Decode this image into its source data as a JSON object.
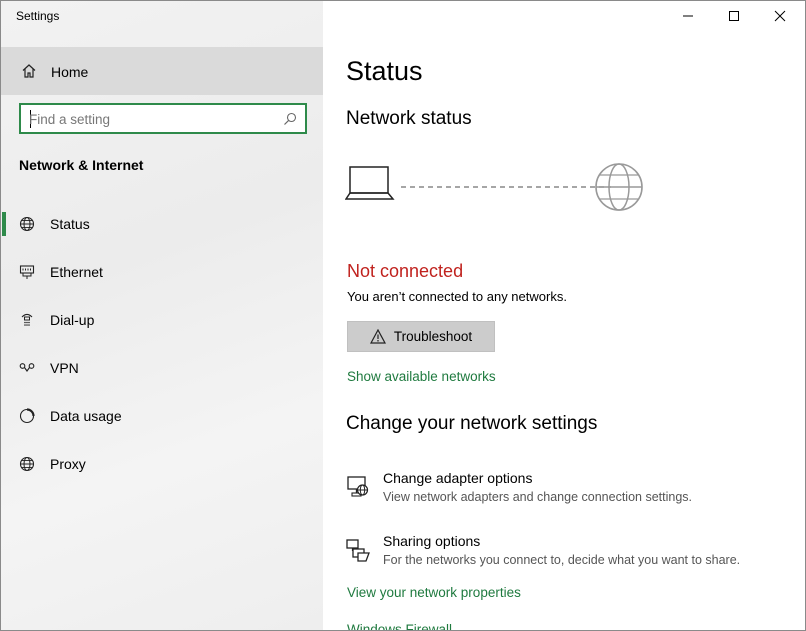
{
  "window": {
    "title": "Settings"
  },
  "sidebar": {
    "home_label": "Home",
    "search": {
      "placeholder": "Find a setting",
      "value": ""
    },
    "section": "Network & Internet",
    "items": [
      {
        "label": "Status",
        "icon": "globe-status-icon",
        "selected": true
      },
      {
        "label": "Ethernet",
        "icon": "ethernet-icon"
      },
      {
        "label": "Dial-up",
        "icon": "dialup-icon"
      },
      {
        "label": "VPN",
        "icon": "vpn-icon"
      },
      {
        "label": "Data usage",
        "icon": "data-usage-icon"
      },
      {
        "label": "Proxy",
        "icon": "globe-icon"
      }
    ]
  },
  "main": {
    "title": "Status",
    "network_status_heading": "Network status",
    "status": "Not connected",
    "status_description": "You aren’t connected to any networks.",
    "troubleshoot_label": "Troubleshoot",
    "show_networks_link": "Show available networks",
    "change_heading": "Change your network settings",
    "options": [
      {
        "title": "Change adapter options",
        "description": "View network adapters and change connection settings."
      },
      {
        "title": "Sharing options",
        "description": "For the networks you connect to, decide what you want to share."
      }
    ],
    "view_properties_link": "View your network properties",
    "firewall_link": "Windows Firewall"
  },
  "colors": {
    "accent": "#2e8a4a",
    "error": "#c0221e",
    "link": "#1f7a3f",
    "sidebar_selected": "#dadada"
  }
}
